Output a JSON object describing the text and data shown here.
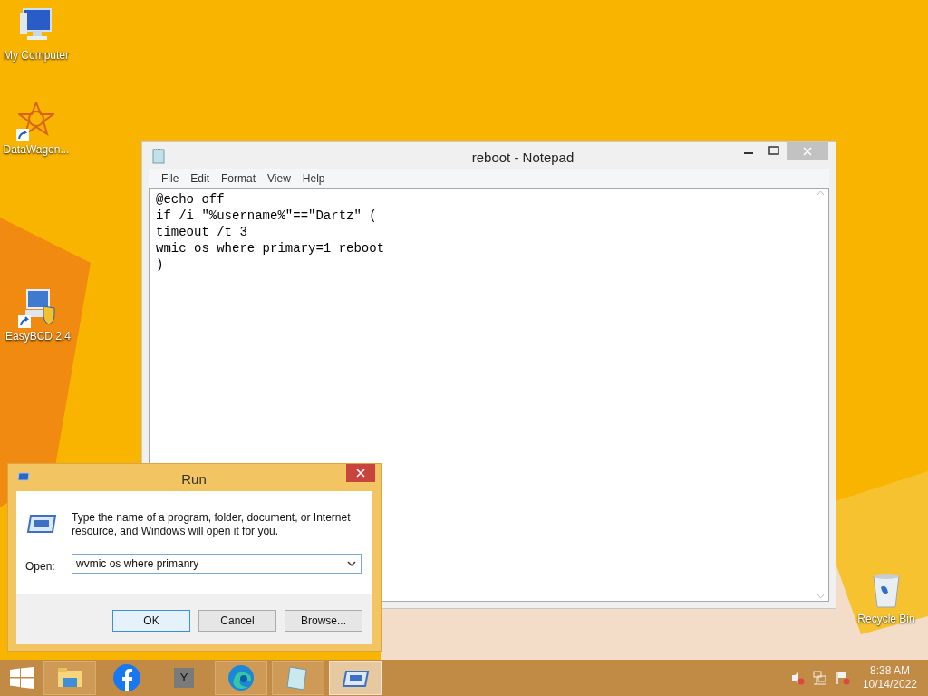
{
  "desktop_icons": [
    {
      "label": "My Computer",
      "kind": "computer",
      "shortcut": false
    },
    {
      "label": "DataWagon...",
      "kind": "star",
      "shortcut": true
    },
    {
      "label": "EasyBCD 2.4",
      "kind": "setup",
      "shortcut": true
    },
    {
      "label": "Recycle Bin",
      "kind": "bin",
      "shortcut": false
    }
  ],
  "notepad": {
    "title": "reboot - Notepad",
    "menu": [
      "File",
      "Edit",
      "Format",
      "View",
      "Help"
    ],
    "lines": [
      "@echo off",
      "if /i \"%username%\"==\"Dartz\" (",
      "timeout /t 3",
      "wmic os where primary=1 reboot",
      ")"
    ]
  },
  "run_dialog": {
    "title": "Run",
    "description": "Type the name of a program, folder, document, or Internet resource, and Windows will open it for you.",
    "open_label": "Open:",
    "value": "wvmic os where primanry",
    "buttons": [
      {
        "label": "OK",
        "default": true
      },
      {
        "label": "Cancel",
        "default": false
      },
      {
        "label": "Browse...",
        "default": false
      }
    ]
  },
  "taskbar": {
    "items": [
      {
        "kind": "explorer",
        "selected": false
      },
      {
        "kind": "facebook",
        "selected": false
      },
      {
        "kind": "letter",
        "label": "Y",
        "selected": false
      },
      {
        "kind": "edge",
        "selected": false
      },
      {
        "kind": "notepad",
        "selected": false
      },
      {
        "kind": "run",
        "selected": true
      }
    ]
  },
  "tray": {
    "time": "8:38 AM",
    "date": "10/14/2022"
  }
}
